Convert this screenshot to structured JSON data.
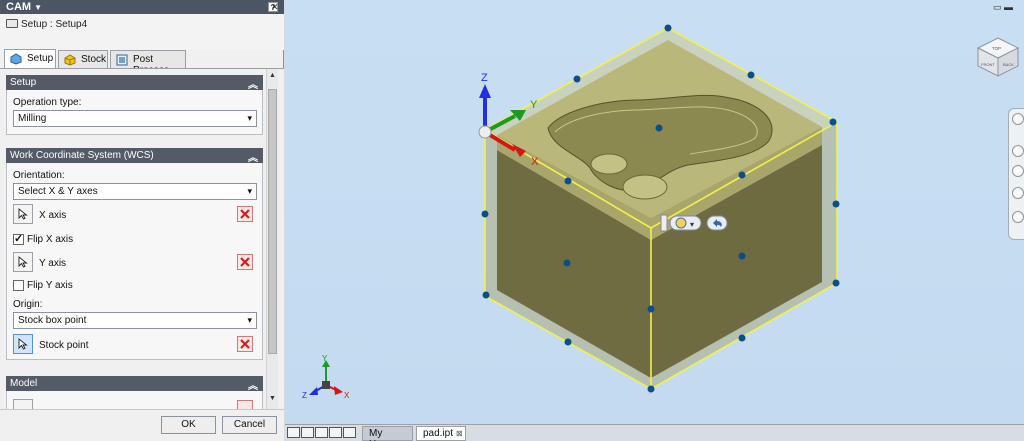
{
  "panel": {
    "title": "CAM",
    "help": "?",
    "setup_path": "Setup : Setup4",
    "tabs": [
      {
        "label": "Setup"
      },
      {
        "label": "Stock"
      },
      {
        "label": "Post Process"
      }
    ],
    "sections": {
      "setup": {
        "title": "Setup",
        "op_type_label": "Operation type:",
        "op_type_value": "Milling"
      },
      "wcs": {
        "title": "Work Coordinate System (WCS)",
        "orientation_label": "Orientation:",
        "orientation_value": "Select X & Y axes",
        "x_axis": "X axis",
        "flip_x": "Flip X axis",
        "flip_x_checked": true,
        "y_axis": "Y axis",
        "flip_y": "Flip Y axis",
        "flip_y_checked": false,
        "origin_label": "Origin:",
        "origin_value": "Stock box point",
        "stock_point": "Stock point"
      },
      "model": {
        "title": "Model"
      }
    },
    "buttons": {
      "ok": "OK",
      "cancel": "Cancel"
    }
  },
  "viewport": {
    "axis_labels": {
      "x": "X",
      "y": "Y",
      "z": "Z"
    },
    "triad_labels": {
      "x": "X",
      "y": "Y",
      "z": "Z"
    },
    "viewcube_faces": {
      "top": "TOP",
      "front": "FRONT",
      "right": "BACK"
    }
  },
  "document_tabs": [
    {
      "label": "My Home"
    },
    {
      "label": "pad.ipt"
    }
  ],
  "colors": {
    "panel_header": "#4b5563",
    "section_header": "#545b66",
    "viewport_bg": "#c8dff3",
    "stock_face": "#7a7748",
    "stock_edge": "#f4f04a",
    "grip": "#0b4f8a"
  }
}
